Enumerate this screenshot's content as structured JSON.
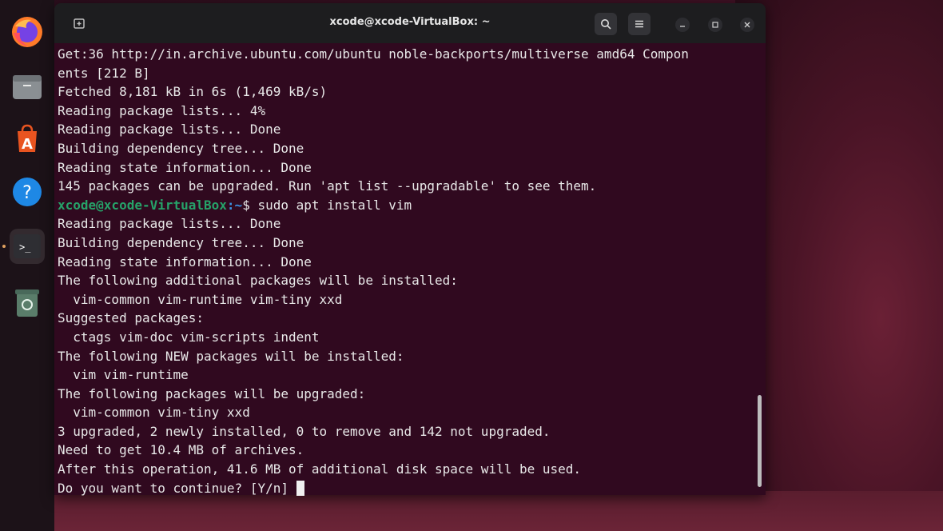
{
  "window": {
    "title": "xcode@xcode-VirtualBox: ~",
    "new_tab_icon": "new-tab-icon",
    "search_icon": "search-icon",
    "menu_icon": "hamburger-menu-icon"
  },
  "dock": {
    "items": [
      "firefox-icon",
      "files-icon",
      "app-center-icon",
      "help-icon",
      "terminal-icon",
      "trash-icon"
    ]
  },
  "terminal": {
    "lines": [
      "Get:36 http://in.archive.ubuntu.com/ubuntu noble-backports/multiverse amd64 Compon",
      "ents [212 B]",
      "Fetched 8,181 kB in 6s (1,469 kB/s)",
      "Reading package lists... 4%",
      "Reading package lists... Done",
      "Building dependency tree... Done",
      "Reading state information... Done",
      "145 packages can be upgraded. Run 'apt list --upgradable' to see them."
    ],
    "prompt_user": "xcode@xcode-VirtualBox",
    "prompt_path": ":~",
    "prompt_command": "$ sudo apt install vim",
    "lines_after": [
      "Reading package lists... Done",
      "Building dependency tree... Done",
      "Reading state information... Done",
      "The following additional packages will be installed:",
      "  vim-common vim-runtime vim-tiny xxd",
      "Suggested packages:",
      "  ctags vim-doc vim-scripts indent",
      "The following NEW packages will be installed:",
      "  vim vim-runtime",
      "The following packages will be upgraded:",
      "  vim-common vim-tiny xxd",
      "3 upgraded, 2 newly installed, 0 to remove and 142 not upgraded.",
      "Need to get 10.4 MB of archives.",
      "After this operation, 41.6 MB of additional disk space will be used."
    ],
    "final_prompt": "Do you want to continue? [Y/n] "
  },
  "colors": {
    "terminal_bg": "#30091f",
    "prompt_user": "#26a269",
    "prompt_path": "#3a8fe0",
    "titlebar": "#1d1d1f"
  }
}
